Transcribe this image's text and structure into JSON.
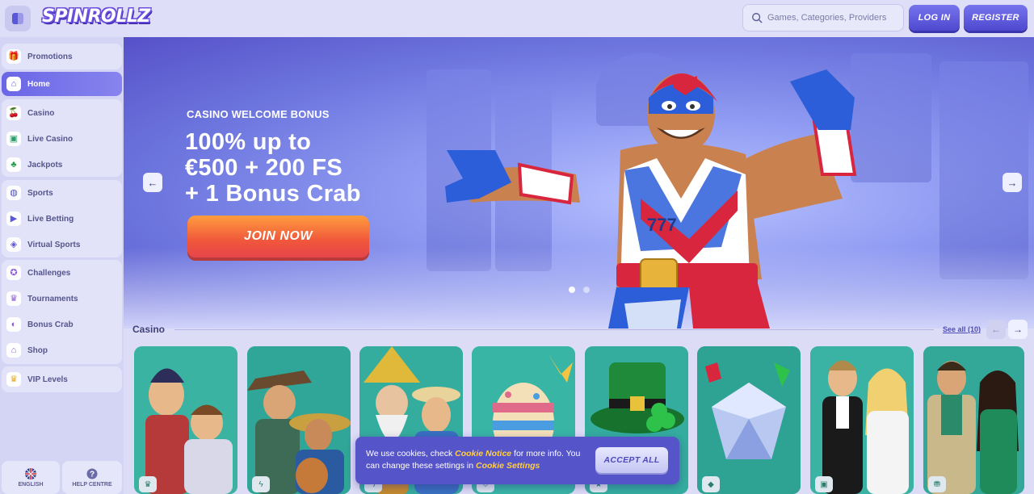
{
  "header": {
    "logo_text": "SPINROLLZ",
    "search_placeholder": "Games, Categories, Providers",
    "login_label": "LOG IN",
    "register_label": "REGISTER"
  },
  "sidebar": {
    "items": [
      {
        "label": "Promotions",
        "icon": "gift-icon",
        "glyph": "🎁"
      },
      {
        "label": "Home",
        "icon": "home-icon",
        "glyph": "⌂",
        "active": true
      },
      {
        "label": "Casino",
        "icon": "cherries-icon",
        "glyph": "🍒"
      },
      {
        "label": "Live Casino",
        "icon": "cards-icon",
        "glyph": "🃏"
      },
      {
        "label": "Jackpots",
        "icon": "clover-icon",
        "glyph": "♣"
      },
      {
        "label": "Sports",
        "icon": "ball-icon",
        "glyph": "⚽"
      },
      {
        "label": "Live Betting",
        "icon": "play-icon",
        "glyph": "▶"
      },
      {
        "label": "Virtual Sports",
        "icon": "gamepad-icon",
        "glyph": "🎮"
      },
      {
        "label": "Challenges",
        "icon": "medal-icon",
        "glyph": "🏅"
      },
      {
        "label": "Tournaments",
        "icon": "trophy-icon",
        "glyph": "🏆"
      },
      {
        "label": "Bonus Crab",
        "icon": "crab-icon",
        "glyph": "🦀"
      },
      {
        "label": "Shop",
        "icon": "shop-icon",
        "glyph": "🏪"
      },
      {
        "label": "VIP Levels",
        "icon": "crown-icon",
        "glyph": "👑"
      }
    ],
    "language_label": "ENGLISH",
    "help_label": "HELP CENTRE"
  },
  "banner": {
    "kicker": "CASINO WELCOME BONUS",
    "headline_lines": [
      "100% up to",
      "€500 + 200 FS",
      "+ 1 Bonus Crab"
    ],
    "cta_label": "JOIN NOW",
    "slide_count": 2,
    "active_slide": 1
  },
  "casino": {
    "title": "Casino",
    "see_all": "See all (10)",
    "tiles": [
      {
        "name": "pirate-knight",
        "badge_icon": "crown-icon",
        "bg": "#3ab3a3"
      },
      {
        "name": "cowboys",
        "badge_icon": "bolt-icon",
        "bg": "#2fa697"
      },
      {
        "name": "wizard-sailor",
        "badge_icon": "bolt-icon",
        "bg": "#35ad9e"
      },
      {
        "name": "easter-egg",
        "badge_icon": "shield-icon",
        "bg": "#39b5a6"
      },
      {
        "name": "leprechaun-hat",
        "badge_icon": "star-icon",
        "bg": "#34ad9f"
      },
      {
        "name": "diamond",
        "badge_icon": "diamond-icon",
        "bg": "#2ea394"
      },
      {
        "name": "roulette-hosts",
        "badge_icon": "cards-icon",
        "bg": "#3ab2a4"
      },
      {
        "name": "blackjack-hosts",
        "badge_icon": "chip-icon",
        "bg": "#33a898"
      }
    ]
  },
  "cookie": {
    "text_1": "We use cookies, check ",
    "link_1": "Cookie Notice",
    "text_2": " for more info. You can change these settings in ",
    "link_2": "Cookie Settings",
    "accept_label": "ACCEPT ALL"
  }
}
